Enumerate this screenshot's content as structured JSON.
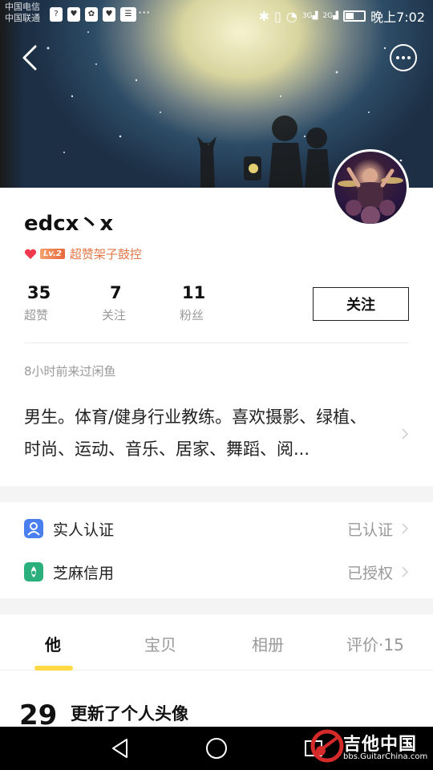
{
  "status_bar": {
    "carrier_line1": "中国电信",
    "carrier_line2": "中国联通",
    "time": "晚上7:02",
    "net_1": "3G",
    "net_2": "2G"
  },
  "header": {
    "back_icon": "back-arrow-icon",
    "more_icon": "more-dots-icon"
  },
  "profile": {
    "name": "edcx丶x",
    "level": "Lv.2",
    "badge_text": "超赞架子鼓控",
    "stats": [
      {
        "num": "35",
        "label": "超赞"
      },
      {
        "num": "7",
        "label": "关注"
      },
      {
        "num": "11",
        "label": "粉丝"
      }
    ],
    "follow_label": "关注",
    "last_visit": "8小时前来过闲鱼",
    "bio": "男生。体育/健身行业教练。喜欢摄影、绿植、时尚、运动、音乐、居家、舞蹈、阅..."
  },
  "certs": [
    {
      "label": "实人认证",
      "value": "已认证",
      "icon": "person-verify-icon",
      "color": "#4a7ff0"
    },
    {
      "label": "芝麻信用",
      "value": "已授权",
      "icon": "sesame-credit-icon",
      "color": "#2bb07d"
    }
  ],
  "tabs": [
    {
      "label": "他",
      "active": true
    },
    {
      "label": "宝贝",
      "active": false
    },
    {
      "label": "相册",
      "active": false
    },
    {
      "label": "评价·15",
      "active": false
    }
  ],
  "feed": {
    "day": "29",
    "text": "更新了个人头像"
  },
  "watermark": {
    "title": "吉他中国",
    "url": "bbs.GuitarChina.com"
  },
  "colors": {
    "accent_yellow": "#ffda44",
    "badge_orange": "#e27849"
  }
}
